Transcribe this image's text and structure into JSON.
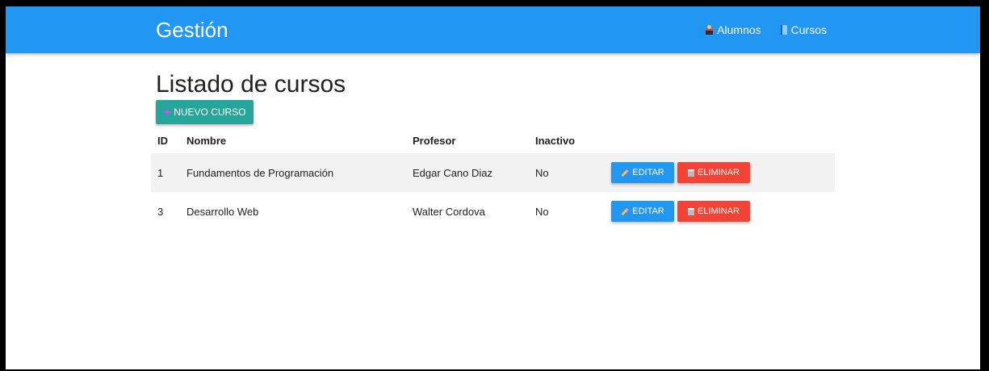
{
  "navbar": {
    "brand": "Gestión",
    "links": [
      {
        "label": "Alumnos",
        "icon": "student-icon"
      },
      {
        "label": "Cursos",
        "icon": "book-icon"
      }
    ]
  },
  "page": {
    "title": "Listado de cursos",
    "new_button_label": "NUEVO CURSO"
  },
  "table": {
    "headers": {
      "id": "ID",
      "nombre": "Nombre",
      "profesor": "Profesor",
      "inactivo": "Inactivo"
    },
    "rows": [
      {
        "id": "1",
        "nombre": "Fundamentos de Programación",
        "profesor": "Edgar Cano Diaz",
        "inactivo": "No"
      },
      {
        "id": "3",
        "nombre": "Desarrollo Web",
        "profesor": "Walter Cordova",
        "inactivo": "No"
      }
    ],
    "edit_label": "EDITAR",
    "delete_label": "ELIMINAR"
  },
  "colors": {
    "primary": "#2196f3",
    "teal": "#26a69a",
    "danger": "#f44336"
  }
}
